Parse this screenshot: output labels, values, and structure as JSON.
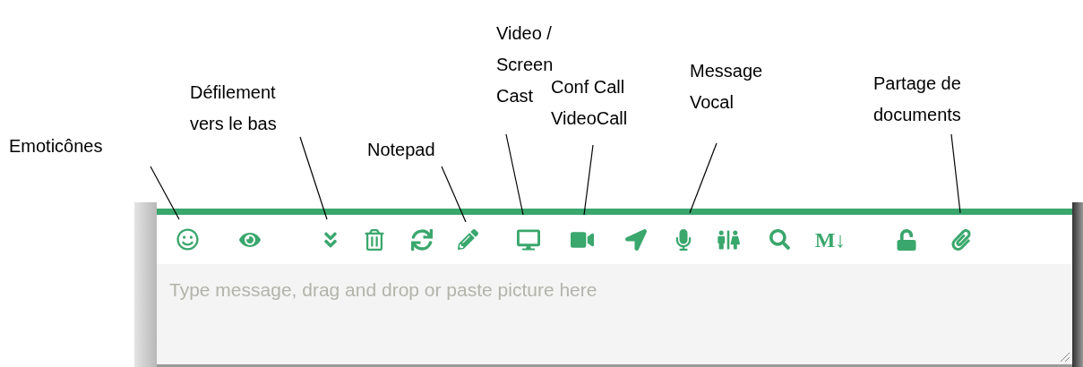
{
  "callouts": [
    {
      "lines": [
        "Emoticônes"
      ]
    },
    {
      "lines": [
        "Défilement",
        "vers le bas"
      ]
    },
    {
      "lines": [
        "Notepad"
      ]
    },
    {
      "lines": [
        "Video /",
        "Screen",
        "Cast"
      ]
    },
    {
      "lines": [
        "Conf Call",
        "VideoCall"
      ]
    },
    {
      "lines": [
        "Message",
        "Vocal"
      ]
    },
    {
      "lines": [
        "Partage de",
        "documents"
      ]
    }
  ],
  "toolbar": {
    "markdown_button": "M↓"
  },
  "composer": {
    "placeholder": "Type message, drag and drop or paste picture here"
  }
}
